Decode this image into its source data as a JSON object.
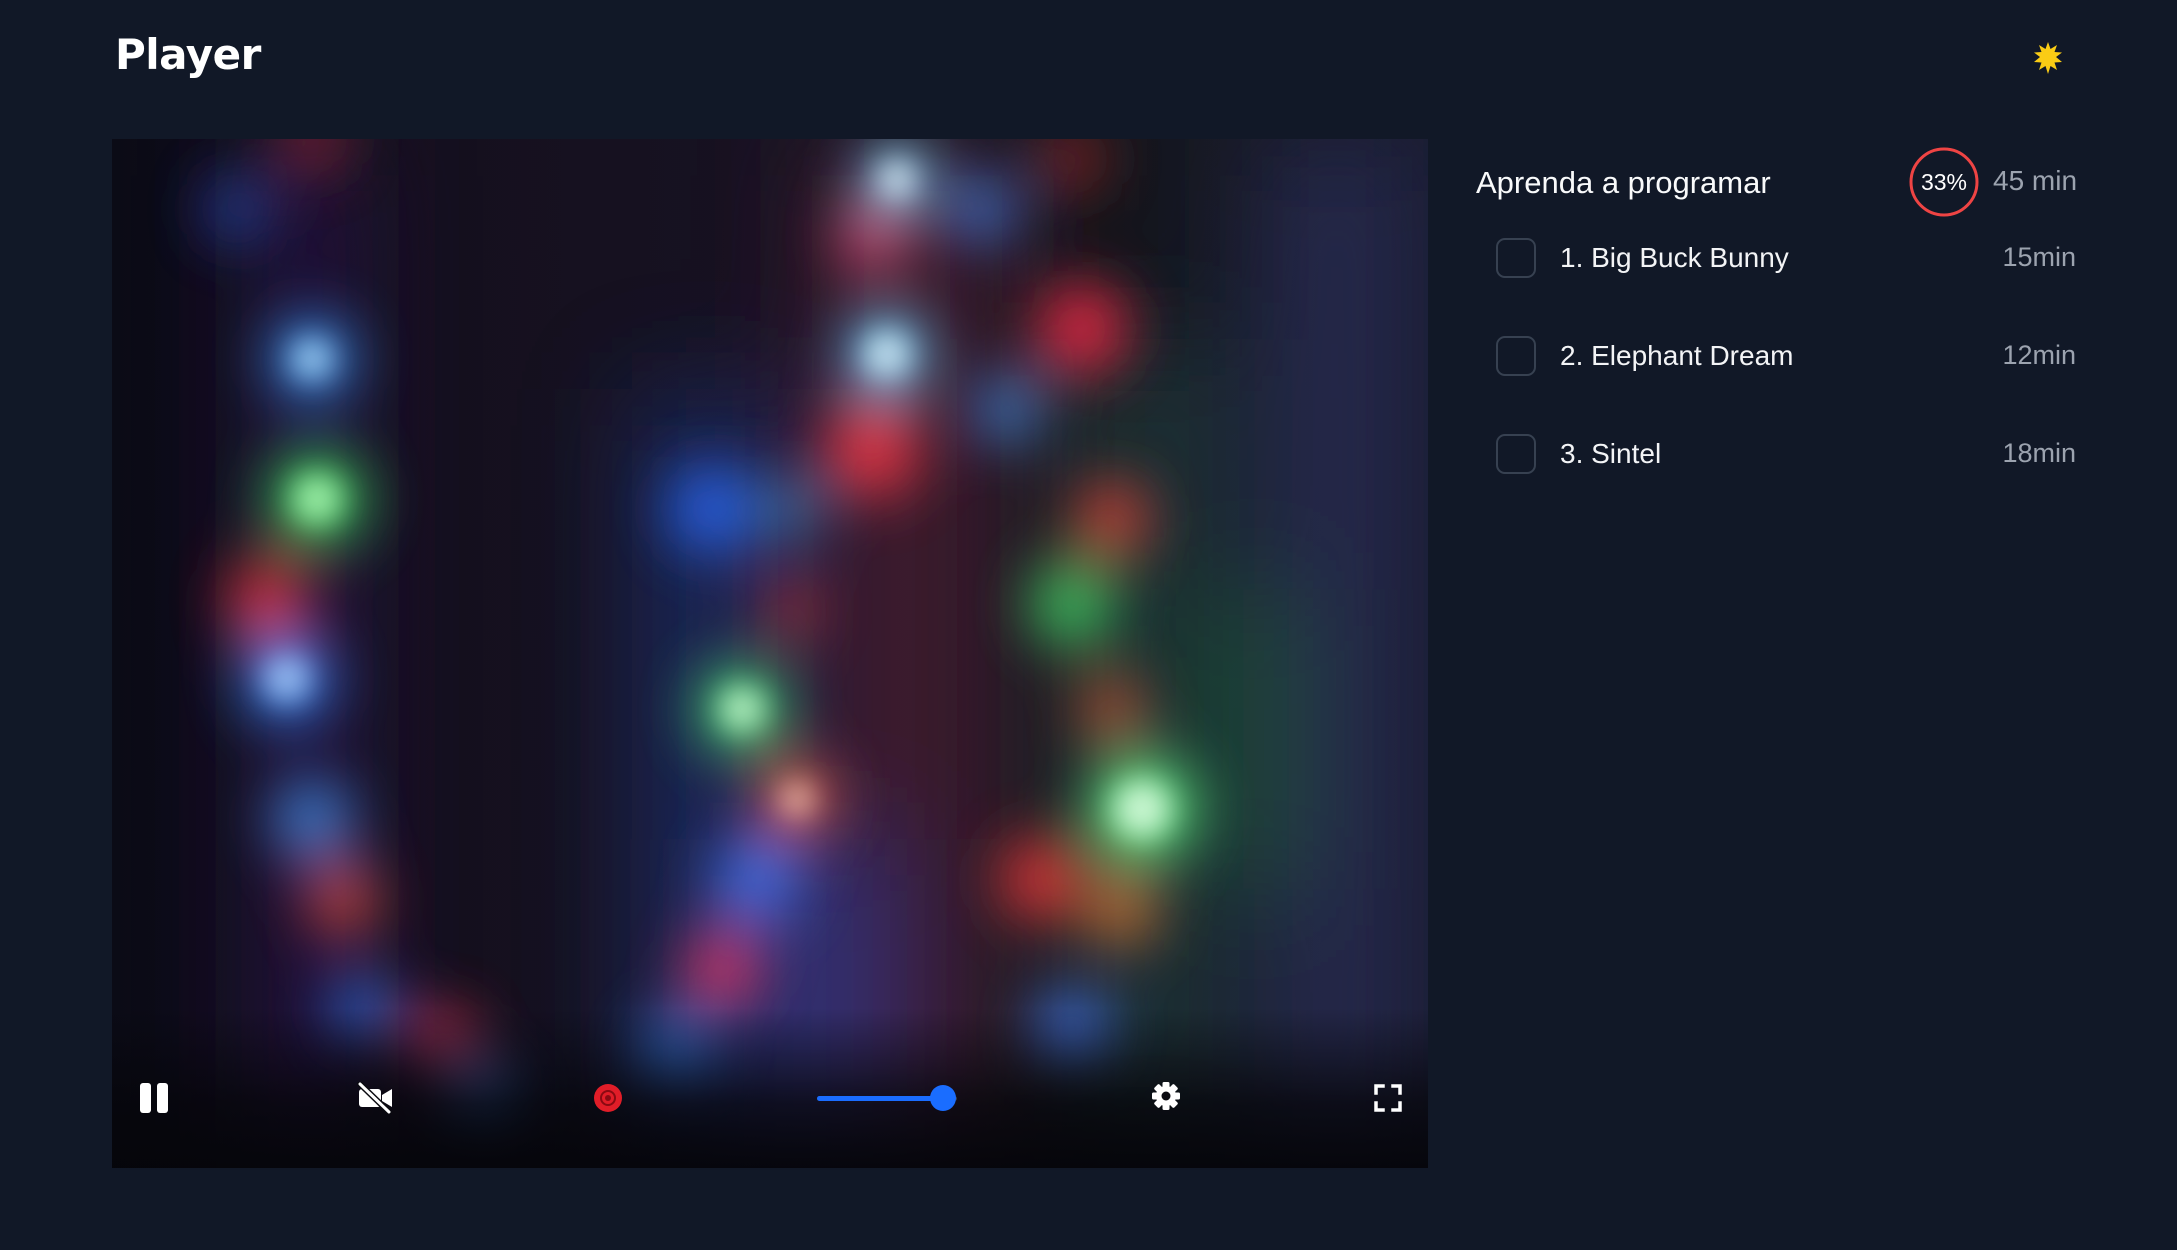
{
  "header": {
    "title": "Player",
    "theme_icon": "sun-icon",
    "theme_icon_color": "#facc15"
  },
  "player": {
    "state": "playing",
    "controls": {
      "play_pause_icon": "pause-icon",
      "camera_icon": "video-off-icon",
      "record_icon": "record-icon",
      "record_color": "#e11d28",
      "settings_icon": "gear-icon",
      "fullscreen_icon": "fullscreen-icon"
    },
    "volume": 0.9,
    "accent_color": "#1a6dff"
  },
  "course": {
    "title": "Aprenda a programar",
    "progress_percent": 33,
    "progress_label": "33%",
    "progress_color": "#ef4444",
    "total_duration": "45 min",
    "lessons": [
      {
        "title": "1. Big Buck Bunny",
        "duration": "15min",
        "completed": false
      },
      {
        "title": "2. Elephant Dream",
        "duration": "12min",
        "completed": false
      },
      {
        "title": "3. Sintel",
        "duration": "18min",
        "completed": false
      }
    ]
  }
}
